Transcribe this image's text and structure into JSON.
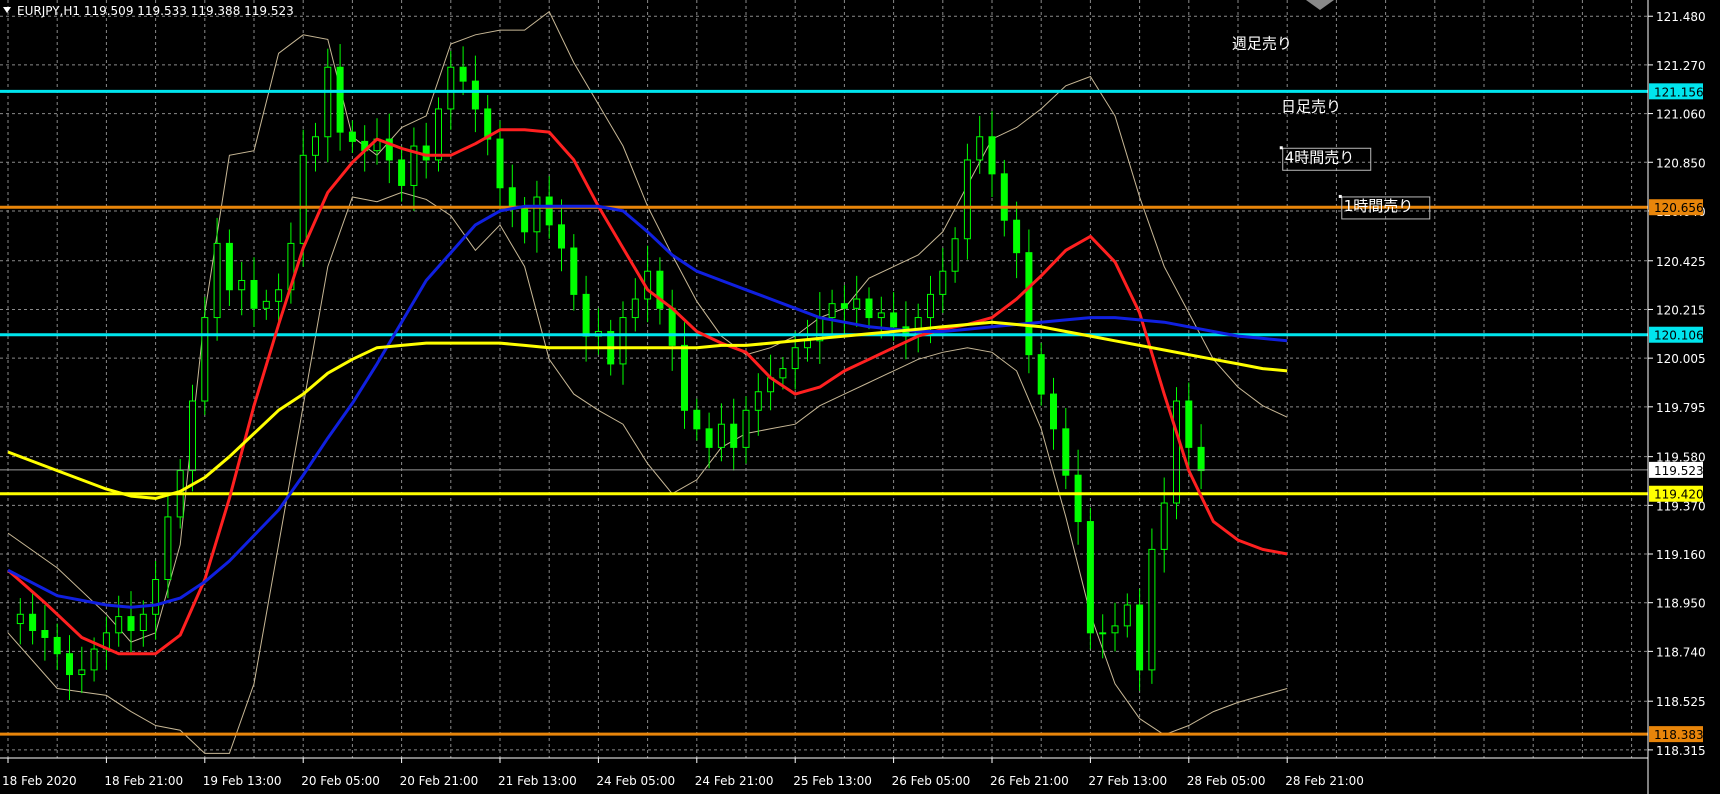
{
  "chart_data": {
    "type": "candlestick",
    "title": "EURJPY,H1  119.509 119.533 119.388 119.523",
    "ylim": [
      118.28,
      121.55
    ],
    "xlim": [
      0,
      144
    ],
    "grid": true,
    "y_ticks": [
      121.48,
      121.27,
      121.06,
      120.85,
      120.64,
      120.425,
      120.215,
      120.005,
      119.795,
      119.58,
      119.37,
      119.16,
      118.95,
      118.74,
      118.525,
      118.315
    ],
    "y_tick_labels": [
      "121.480",
      "121.270",
      "121.060",
      "120.850",
      "120.640",
      "120.425",
      "120.215",
      "120.005",
      "119.795",
      "119.580",
      "119.370",
      "119.160",
      "118.950",
      "118.740",
      "118.525",
      "118.315"
    ],
    "x_ticks": [
      {
        "x": 0,
        "label": "18 Feb 2020"
      },
      {
        "x": 8,
        "label": "18 Feb 21:00"
      },
      {
        "x": 16,
        "label": "19 Feb 13:00"
      },
      {
        "x": 24,
        "label": "20 Feb 05:00"
      },
      {
        "x": 32,
        "label": "20 Feb 21:00"
      },
      {
        "x": 40,
        "label": "21 Feb 13:00"
      },
      {
        "x": 48,
        "label": "24 Feb 05:00"
      },
      {
        "x": 56,
        "label": "24 Feb 21:00"
      },
      {
        "x": 64,
        "label": "25 Feb 13:00"
      },
      {
        "x": 72,
        "label": "26 Feb 05:00"
      },
      {
        "x": 80,
        "label": "26 Feb 21:00"
      },
      {
        "x": 88,
        "label": "27 Feb 13:00"
      },
      {
        "x": 96,
        "label": "28 Feb 05:00"
      },
      {
        "x": 104,
        "label": "28 Feb 21:00"
      }
    ],
    "horizontal_lines": [
      {
        "price": 121.156,
        "label": "121.156",
        "color": "#00e5ee",
        "box_color": "#00e5ee",
        "text_color": "#000000"
      },
      {
        "price": 120.656,
        "label": "120.656",
        "color": "#e8850a",
        "box_color": "#e8850a",
        "text_color": "#000000"
      },
      {
        "price": 120.106,
        "label": "120.106",
        "color": "#00e5ee",
        "box_color": "#00e5ee",
        "text_color": "#000000"
      },
      {
        "price": 119.42,
        "label": "119.420",
        "color": "#ffff00",
        "box_color": "#ffff00",
        "text_color": "#000000"
      },
      {
        "price": 118.383,
        "label": "118.383",
        "color": "#e8850a",
        "box_color": "#e8850a",
        "text_color": "#000000"
      }
    ],
    "current_price": {
      "price": 119.523,
      "label": "119.523"
    },
    "series": [
      {
        "role": "ma_red",
        "color": "#ff2020",
        "x": [
          0,
          3,
          6,
          9,
          12,
          14,
          16,
          18,
          20,
          22,
          24,
          26,
          28,
          30,
          32,
          34,
          36,
          38,
          40,
          42,
          44,
          46,
          48,
          50,
          52,
          54,
          56,
          58,
          60,
          62,
          64,
          66,
          68,
          70,
          72,
          74,
          76,
          78,
          80,
          82,
          84,
          86,
          88,
          90,
          92,
          94,
          96,
          98,
          100,
          102,
          104
        ],
        "y": [
          119.09,
          118.95,
          118.8,
          118.73,
          118.73,
          118.81,
          119.05,
          119.4,
          119.8,
          120.15,
          120.48,
          120.72,
          120.85,
          120.95,
          120.91,
          120.88,
          120.88,
          120.93,
          120.99,
          120.99,
          120.98,
          120.86,
          120.66,
          120.48,
          120.3,
          120.22,
          120.12,
          120.07,
          120.03,
          119.92,
          119.85,
          119.88,
          119.95,
          120.0,
          120.05,
          120.1,
          120.13,
          120.15,
          120.18,
          120.26,
          120.36,
          120.47,
          120.53,
          120.42,
          120.2,
          119.85,
          119.52,
          119.3,
          119.22,
          119.18,
          119.16
        ]
      },
      {
        "role": "ma_blue",
        "color": "#1020e0",
        "x": [
          0,
          4,
          8,
          10,
          12,
          14,
          16,
          18,
          20,
          22,
          24,
          26,
          28,
          30,
          32,
          34,
          36,
          38,
          40,
          42,
          44,
          46,
          48,
          50,
          52,
          54,
          56,
          58,
          60,
          62,
          64,
          66,
          68,
          70,
          72,
          74,
          76,
          78,
          80,
          82,
          84,
          86,
          88,
          90,
          92,
          94,
          96,
          98,
          100,
          102,
          104
        ],
        "y": [
          119.09,
          118.98,
          118.94,
          118.93,
          118.94,
          118.97,
          119.04,
          119.13,
          119.24,
          119.35,
          119.5,
          119.66,
          119.81,
          119.98,
          120.16,
          120.34,
          120.46,
          120.58,
          120.64,
          120.66,
          120.66,
          120.66,
          120.66,
          120.64,
          120.55,
          120.45,
          120.38,
          120.34,
          120.3,
          120.26,
          120.22,
          120.18,
          120.16,
          120.14,
          120.13,
          120.12,
          120.12,
          120.13,
          120.14,
          120.15,
          120.16,
          120.17,
          120.18,
          120.18,
          120.17,
          120.16,
          120.14,
          120.12,
          120.1,
          120.09,
          120.08
        ]
      },
      {
        "role": "ma_yellow",
        "color": "#ffff00",
        "x": [
          0,
          4,
          8,
          10,
          12,
          14,
          16,
          18,
          20,
          22,
          24,
          26,
          28,
          30,
          32,
          34,
          36,
          38,
          40,
          42,
          44,
          46,
          48,
          50,
          52,
          54,
          56,
          58,
          60,
          62,
          64,
          66,
          68,
          70,
          72,
          74,
          76,
          78,
          80,
          82,
          84,
          86,
          88,
          90,
          92,
          94,
          96,
          98,
          100,
          102,
          104
        ],
        "y": [
          119.6,
          119.52,
          119.44,
          119.41,
          119.4,
          119.43,
          119.49,
          119.58,
          119.68,
          119.78,
          119.85,
          119.94,
          120.0,
          120.05,
          120.06,
          120.07,
          120.07,
          120.07,
          120.07,
          120.06,
          120.05,
          120.05,
          120.05,
          120.05,
          120.05,
          120.05,
          120.05,
          120.06,
          120.06,
          120.07,
          120.08,
          120.09,
          120.1,
          120.11,
          120.12,
          120.13,
          120.14,
          120.15,
          120.16,
          120.15,
          120.14,
          120.12,
          120.1,
          120.08,
          120.06,
          120.04,
          120.02,
          120.0,
          119.98,
          119.96,
          119.95
        ]
      },
      {
        "role": "bb_upper",
        "color": "#c8b896",
        "x": [
          0,
          4,
          8,
          10,
          12,
          14,
          16,
          18,
          20,
          22,
          24,
          26,
          28,
          30,
          32,
          34,
          36,
          38,
          40,
          42,
          44,
          46,
          48,
          50,
          52,
          54,
          56,
          58,
          60,
          62,
          64,
          66,
          68,
          70,
          72,
          74,
          76,
          78,
          80,
          82,
          84,
          86,
          88,
          90,
          92,
          94,
          96,
          98,
          100,
          102,
          104
        ],
        "y": [
          119.25,
          119.1,
          118.9,
          118.78,
          118.82,
          119.2,
          120.2,
          120.88,
          120.9,
          121.32,
          121.4,
          121.38,
          120.96,
          120.88,
          121.0,
          121.05,
          121.36,
          121.4,
          121.42,
          121.42,
          121.5,
          121.28,
          121.1,
          120.92,
          120.66,
          120.45,
          120.25,
          120.1,
          120.02,
          120.05,
          120.1,
          120.18,
          120.22,
          120.35,
          120.4,
          120.45,
          120.55,
          120.75,
          120.95,
          121.0,
          121.08,
          121.18,
          121.22,
          121.05,
          120.7,
          120.4,
          120.2,
          120.0,
          119.88,
          119.8,
          119.75
        ]
      },
      {
        "role": "bb_lower",
        "color": "#c8b896",
        "x": [
          0,
          4,
          8,
          10,
          12,
          14,
          16,
          18,
          20,
          22,
          24,
          26,
          28,
          30,
          32,
          34,
          36,
          38,
          40,
          42,
          44,
          46,
          48,
          50,
          52,
          54,
          56,
          58,
          60,
          62,
          64,
          66,
          68,
          70,
          72,
          74,
          76,
          78,
          80,
          82,
          84,
          86,
          88,
          90,
          92,
          94,
          96,
          98,
          100,
          102,
          104
        ],
        "y": [
          118.82,
          118.58,
          118.55,
          118.48,
          118.42,
          118.4,
          118.3,
          118.3,
          118.6,
          119.2,
          119.8,
          120.4,
          120.7,
          120.68,
          120.72,
          120.69,
          120.62,
          120.47,
          120.58,
          120.4,
          120.0,
          119.85,
          119.78,
          119.72,
          119.55,
          119.42,
          119.48,
          119.62,
          119.68,
          119.7,
          119.72,
          119.8,
          119.85,
          119.9,
          119.95,
          120.0,
          120.03,
          120.05,
          120.03,
          119.95,
          119.7,
          119.32,
          118.9,
          118.6,
          118.45,
          118.38,
          118.42,
          118.48,
          118.52,
          118.55,
          118.58
        ]
      }
    ],
    "candles": {
      "color_up": "#00ff00",
      "color_down": "#00ff00",
      "close": [
        118.86,
        118.9,
        118.83,
        118.8,
        118.73,
        118.64,
        118.66,
        118.75,
        118.82,
        118.89,
        118.83,
        118.9,
        119.05,
        119.32,
        119.52,
        119.82,
        120.18,
        120.5,
        120.3,
        120.34,
        120.22,
        120.25,
        120.3,
        120.5,
        120.88,
        120.96,
        121.26,
        120.98,
        120.94,
        120.9,
        120.95,
        120.86,
        120.75,
        120.92,
        120.86,
        121.08,
        121.26,
        121.2,
        121.08,
        120.95,
        120.74,
        120.65,
        120.55,
        120.7,
        120.58,
        120.48,
        120.28,
        120.1,
        120.12,
        119.98,
        120.18,
        120.26,
        120.38,
        120.22,
        120.06,
        119.78,
        119.7,
        119.62,
        119.72,
        119.62,
        119.78,
        119.86,
        119.92,
        119.96,
        120.05,
        120.08,
        120.18,
        120.24,
        120.22,
        120.26,
        120.18,
        120.2,
        120.14,
        120.1,
        120.18,
        120.28,
        120.38,
        120.52,
        120.86,
        120.96,
        120.8,
        120.6,
        120.46,
        120.02,
        119.85,
        119.7,
        119.5,
        119.3,
        118.82,
        118.82,
        118.85,
        118.94,
        118.66,
        119.18,
        119.38,
        119.82,
        119.62,
        119.52
      ]
    },
    "annotations": [
      {
        "text": "週足売り",
        "x": 99.5,
        "y": 121.34,
        "boxed": false
      },
      {
        "text": "日足売り",
        "x": 103.5,
        "y": 121.07,
        "boxed": false
      },
      {
        "text": "4時間売り",
        "x": 103.8,
        "y": 120.85,
        "boxed": true
      },
      {
        "text": "1時間売り",
        "x": 108.6,
        "y": 120.64,
        "boxed": true
      }
    ]
  }
}
